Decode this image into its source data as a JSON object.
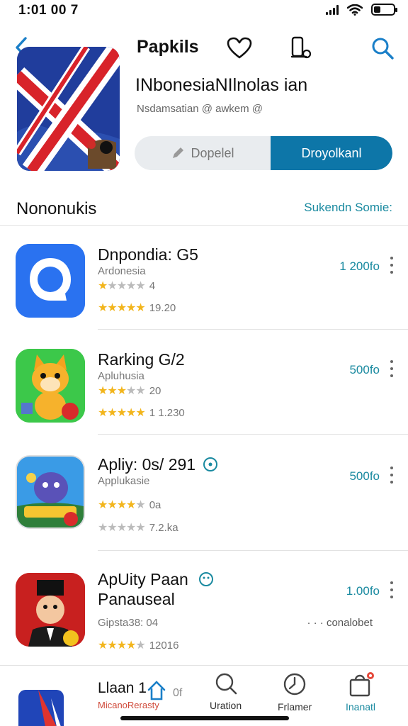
{
  "status_bar": {
    "time": "1:01 00 7"
  },
  "header": {
    "title": "Papkils",
    "subtitle": "INbonesiaNIlnolas ian",
    "meta": "Nsdamsatian @ awkem @",
    "open_label": "Dopelel",
    "download_label": "Droyolkanl"
  },
  "section": {
    "title": "Nononukis",
    "link": "Sukendn Somie:"
  },
  "apps": [
    {
      "name": "Dnpondia: G5",
      "subtitle": "Ardonesia",
      "rating_small": "4",
      "stars_small": 1,
      "stars": 5,
      "reviews": "19.20",
      "price": "1 200fo"
    },
    {
      "name": "Rarking G/2",
      "subtitle": "Apluhusia",
      "rating_small": "20",
      "stars_small": 3,
      "stars": 5,
      "reviews": "1 1.230",
      "price": "500fo"
    },
    {
      "name": "Apliy: 0s/ 291",
      "subtitle": "Applukasie",
      "rating_small": "0a",
      "stars_small": 4,
      "stars": 0,
      "reviews": "7.2.ka",
      "price": "500fo"
    },
    {
      "name": "ApUity Paan",
      "name2": "Panauseal",
      "subtitle": "Gipsta38: 04",
      "stars": 4,
      "reviews": "12016",
      "price": "1.00fo",
      "extra": "· · · conalobet"
    }
  ],
  "tabs": [
    {
      "label": "Llaan 1",
      "sub": "MicanoRerasty",
      "badge_text": "0f"
    },
    {
      "label": "Uration"
    },
    {
      "label": "Frlamer"
    },
    {
      "label": "Inanatl"
    }
  ],
  "colors": {
    "accent": "#0d76a8",
    "link": "#1a8aa0",
    "star": "#f2b51c",
    "badge": "#e5483a"
  }
}
